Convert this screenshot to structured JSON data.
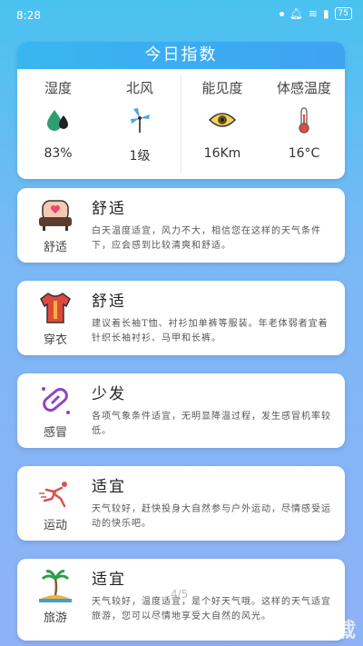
{
  "status_bar": {
    "time": "8:28",
    "battery": "75"
  },
  "header": {
    "title": "今日指数"
  },
  "metrics": [
    {
      "label": "湿度",
      "value": "83%",
      "icon": "humidity-drops-icon"
    },
    {
      "label": "北风",
      "value": "1级",
      "icon": "windmill-icon"
    },
    {
      "label": "能见度",
      "value": "16Km",
      "icon": "eye-icon"
    },
    {
      "label": "体感温度",
      "value": "16°C",
      "icon": "thermometer-icon"
    }
  ],
  "indices": [
    {
      "category": "舒适",
      "title": "舒适",
      "desc": "白天温度适宜，风力不大，相信您在这样的天气条件下，应会感到比较清爽和舒适。",
      "icon": "sofa-icon"
    },
    {
      "category": "穿衣",
      "title": "舒适",
      "desc": "建议着长袖T恤、衬衫加单裤等服装。年老体弱者宜着针织长袖衬衫、马甲和长裤。",
      "icon": "shirt-icon"
    },
    {
      "category": "感冒",
      "title": "少发",
      "desc": "各项气象条件适宜，无明显降温过程，发生感冒机率较低。",
      "icon": "pill-icon"
    },
    {
      "category": "运动",
      "title": "适宜",
      "desc": "天气较好，赶快投身大自然参与户外运动，尽情感受运动的快乐吧。",
      "icon": "runner-icon"
    },
    {
      "category": "旅游",
      "title": "适宜",
      "desc": "天气较好，温度适宜，是个好天气哦。这样的天气适宜旅游，您可以尽情地享受大自然的风光。",
      "icon": "palm-tree-icon"
    }
  ],
  "pager": "4/5",
  "watermark": "一听下载"
}
